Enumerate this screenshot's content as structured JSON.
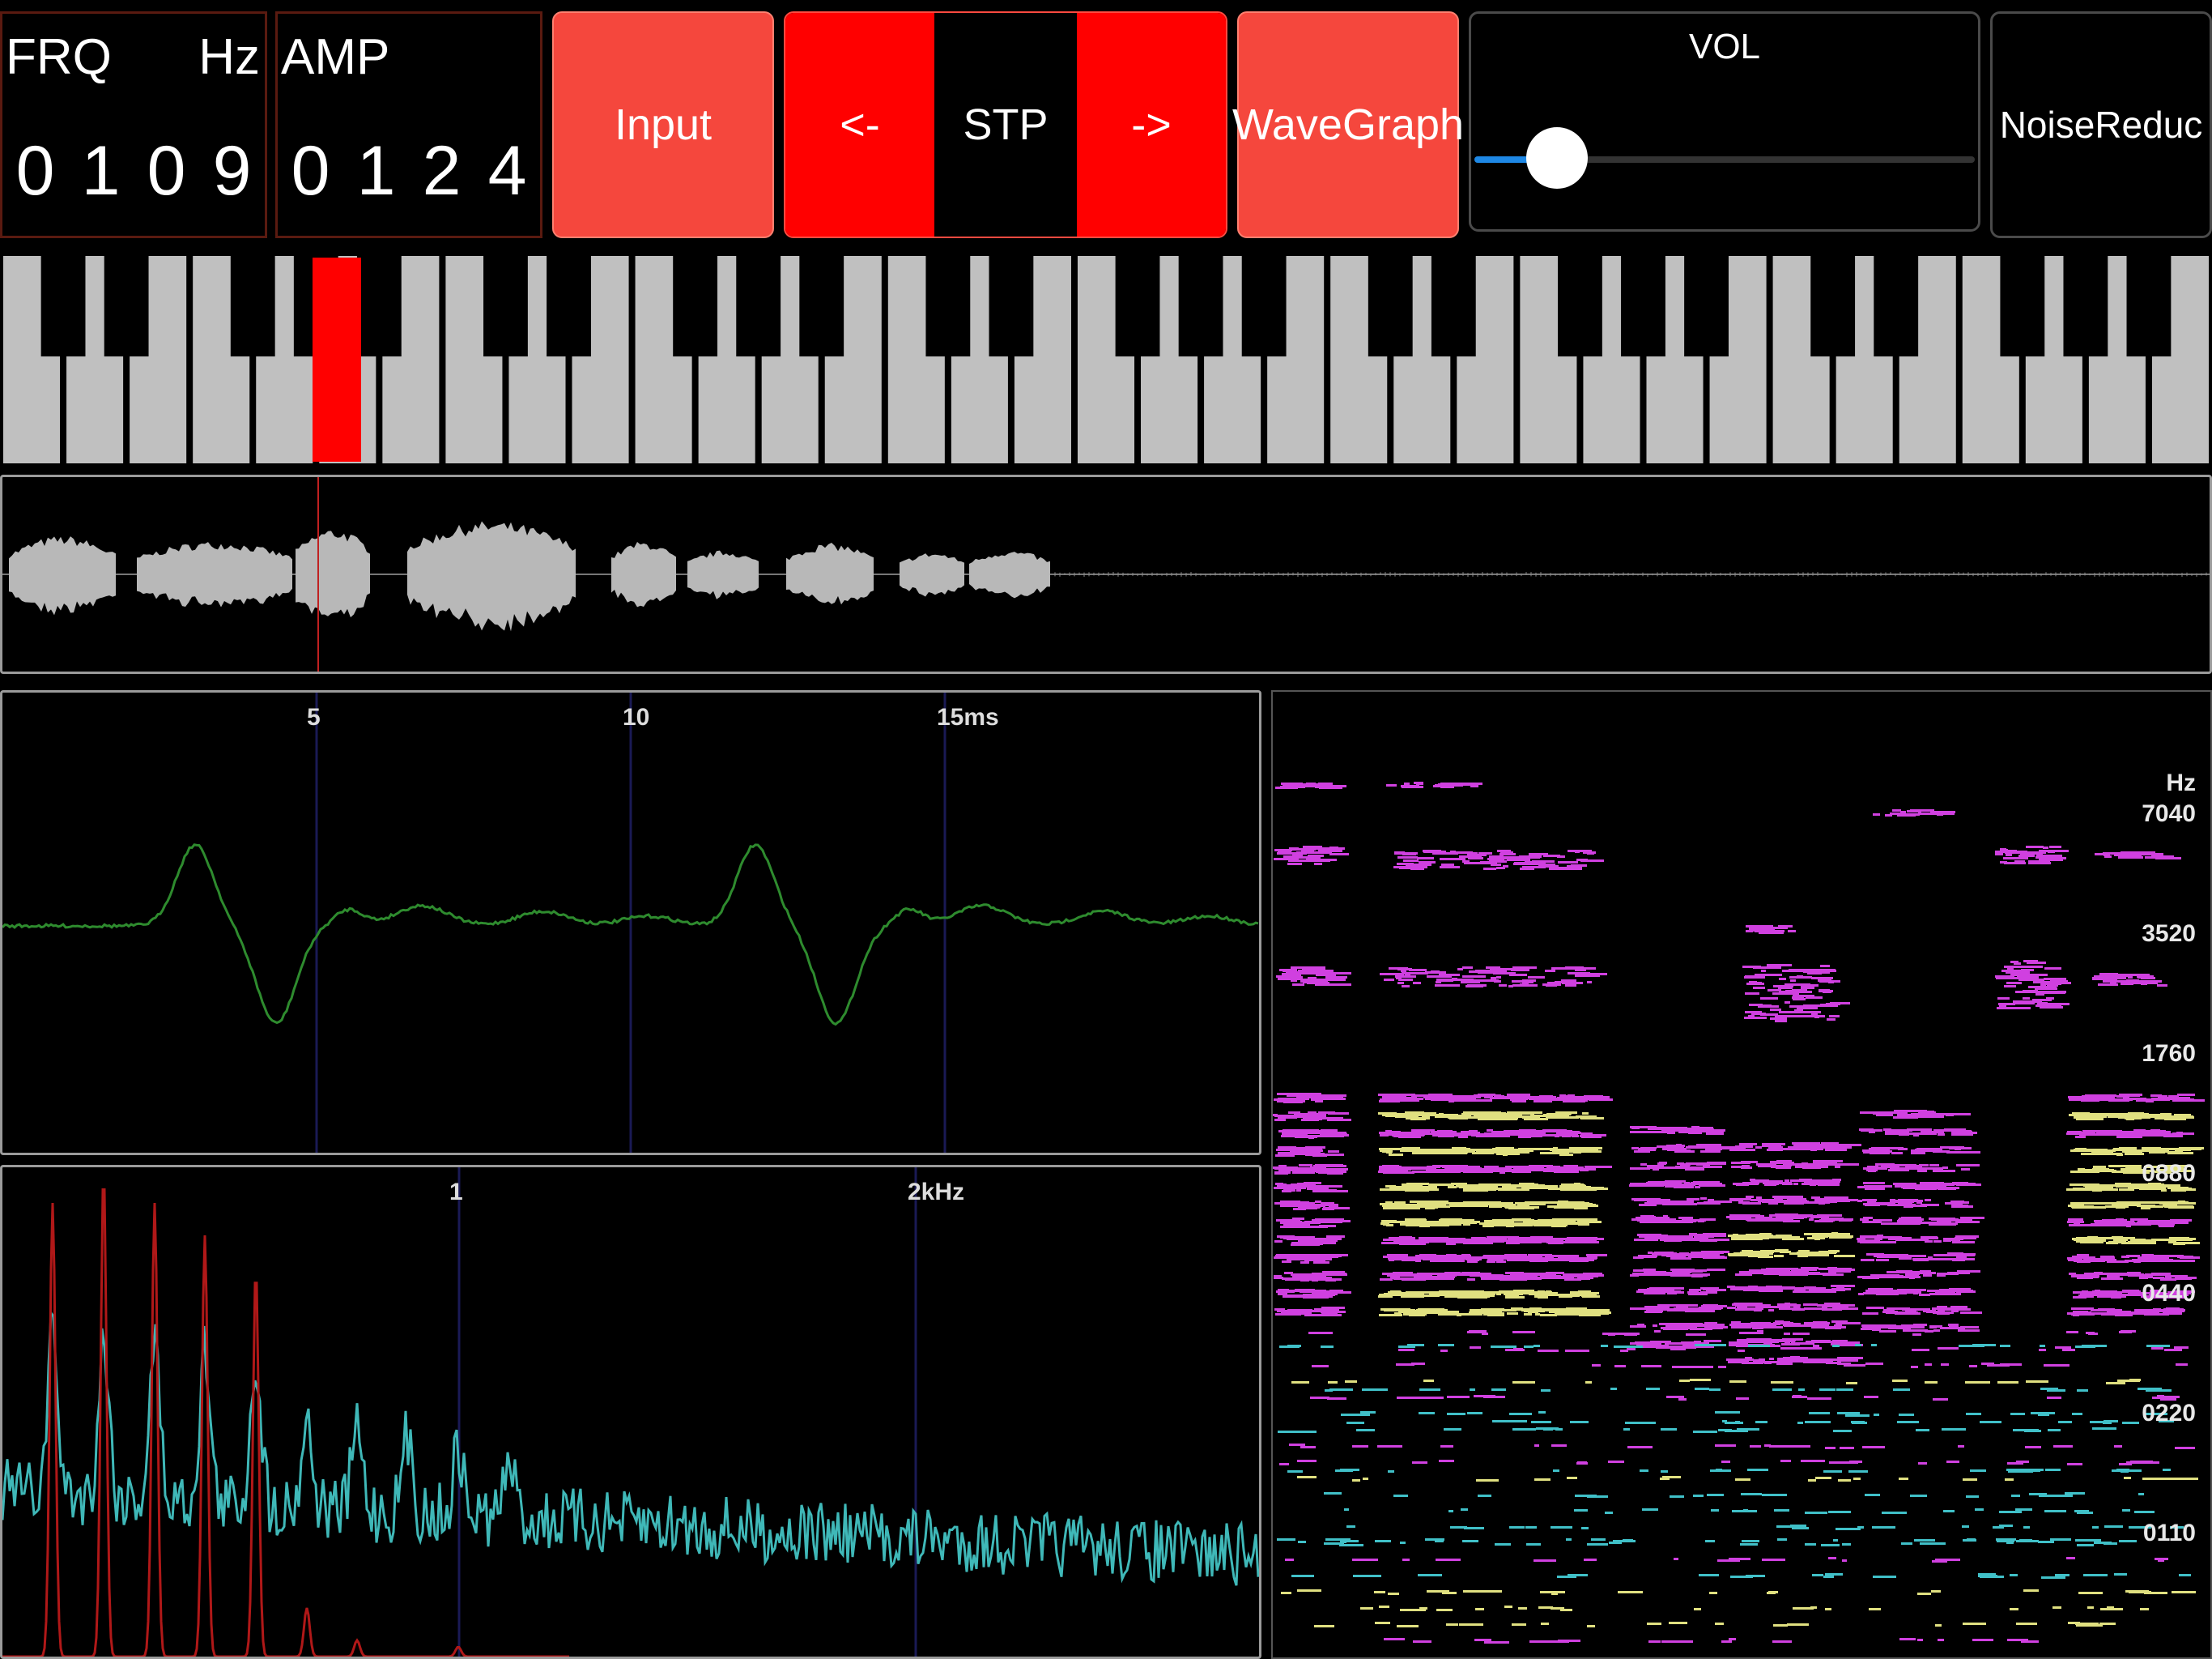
{
  "frq": {
    "label": "FRQ",
    "unit": "Hz",
    "digits": [
      "0",
      "1",
      "0",
      "9"
    ]
  },
  "amp": {
    "label": "AMP",
    "digits": [
      "0",
      "1",
      "2",
      "4"
    ]
  },
  "buttons": {
    "input": "Input",
    "prev": "<-",
    "stop": "STP",
    "next": "->",
    "wavegraph": "WaveGraph",
    "noise": "NoiseReduc"
  },
  "volume": {
    "label": "VOL",
    "level": 0.12
  },
  "keyboard": {
    "highlight_color": "#ff0000",
    "key_color": "#c0c0c0"
  },
  "waveform_panel": {
    "ticks": [
      "5",
      "10",
      "15ms"
    ]
  },
  "spectrum_panel": {
    "ticks": [
      "1",
      "2kHz"
    ]
  },
  "spectrogram": {
    "unit": "Hz",
    "labels": [
      "7040",
      "3520",
      "1760",
      "0880",
      "0440",
      "0220",
      "0110"
    ]
  },
  "colors": {
    "accent_red": "#f5473d",
    "bright_red": "#ff0000",
    "wave_green": "#2e8b2e",
    "spectrum_cyan": "#3fb8b8",
    "spectrum_red": "#b01818",
    "spectrogram_magenta": "#d040e0",
    "spectrogram_cyan": "#40c0c8",
    "spectrogram_yellow": "#e0e080",
    "slider_blue": "#1e88e5"
  }
}
